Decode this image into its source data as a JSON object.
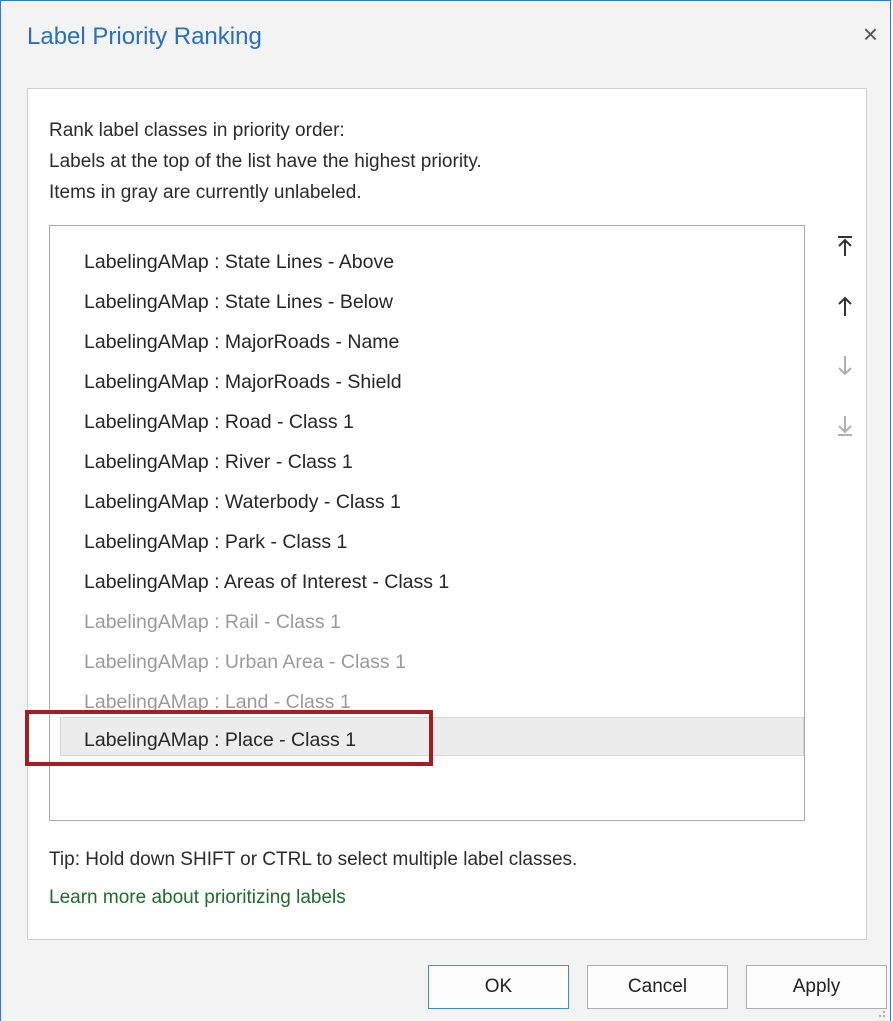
{
  "dialog": {
    "title": "Label Priority Ranking",
    "close_label": "×"
  },
  "instructions": {
    "line1": "Rank label classes in priority order:",
    "line2": "Labels at the top of the list have the highest priority.",
    "line3": "Items in gray are currently unlabeled."
  },
  "label_classes": [
    {
      "text": "LabelingAMap : State Lines - Above",
      "unlabeled": false
    },
    {
      "text": "LabelingAMap : State Lines - Below",
      "unlabeled": false
    },
    {
      "text": "LabelingAMap : MajorRoads - Name",
      "unlabeled": false
    },
    {
      "text": "LabelingAMap : MajorRoads - Shield",
      "unlabeled": false
    },
    {
      "text": "LabelingAMap : Road - Class 1",
      "unlabeled": false
    },
    {
      "text": "LabelingAMap : River - Class 1",
      "unlabeled": false
    },
    {
      "text": "LabelingAMap : Waterbody - Class 1",
      "unlabeled": false
    },
    {
      "text": "LabelingAMap : Park - Class 1",
      "unlabeled": false
    },
    {
      "text": "LabelingAMap : Areas of Interest - Class 1",
      "unlabeled": false
    },
    {
      "text": "LabelingAMap : Rail - Class 1",
      "unlabeled": true
    },
    {
      "text": "LabelingAMap : Urban Area - Class 1",
      "unlabeled": true
    },
    {
      "text": "LabelingAMap : Land - Class 1",
      "unlabeled": true
    },
    {
      "text": "LabelingAMap : Place - Class 1",
      "unlabeled": false,
      "selected": true
    }
  ],
  "side_buttons": [
    {
      "icon": "move-to-top-icon",
      "enabled": true
    },
    {
      "icon": "move-up-icon",
      "enabled": true
    },
    {
      "icon": "move-down-icon",
      "enabled": false
    },
    {
      "icon": "move-to-bottom-icon",
      "enabled": false
    }
  ],
  "tip": "Tip: Hold down SHIFT or CTRL to select multiple label classes.",
  "learn_more_link": "Learn more about prioritizing labels",
  "buttons": {
    "ok": "OK",
    "cancel": "Cancel",
    "apply": "Apply"
  },
  "colors": {
    "title": "#2a6fbf",
    "link": "#1e6b2c",
    "highlight": "#a31e22",
    "unlabeled_text": "#9a9a9a",
    "enabled_icon": "#333333",
    "disabled_icon": "#b0b0b0"
  }
}
